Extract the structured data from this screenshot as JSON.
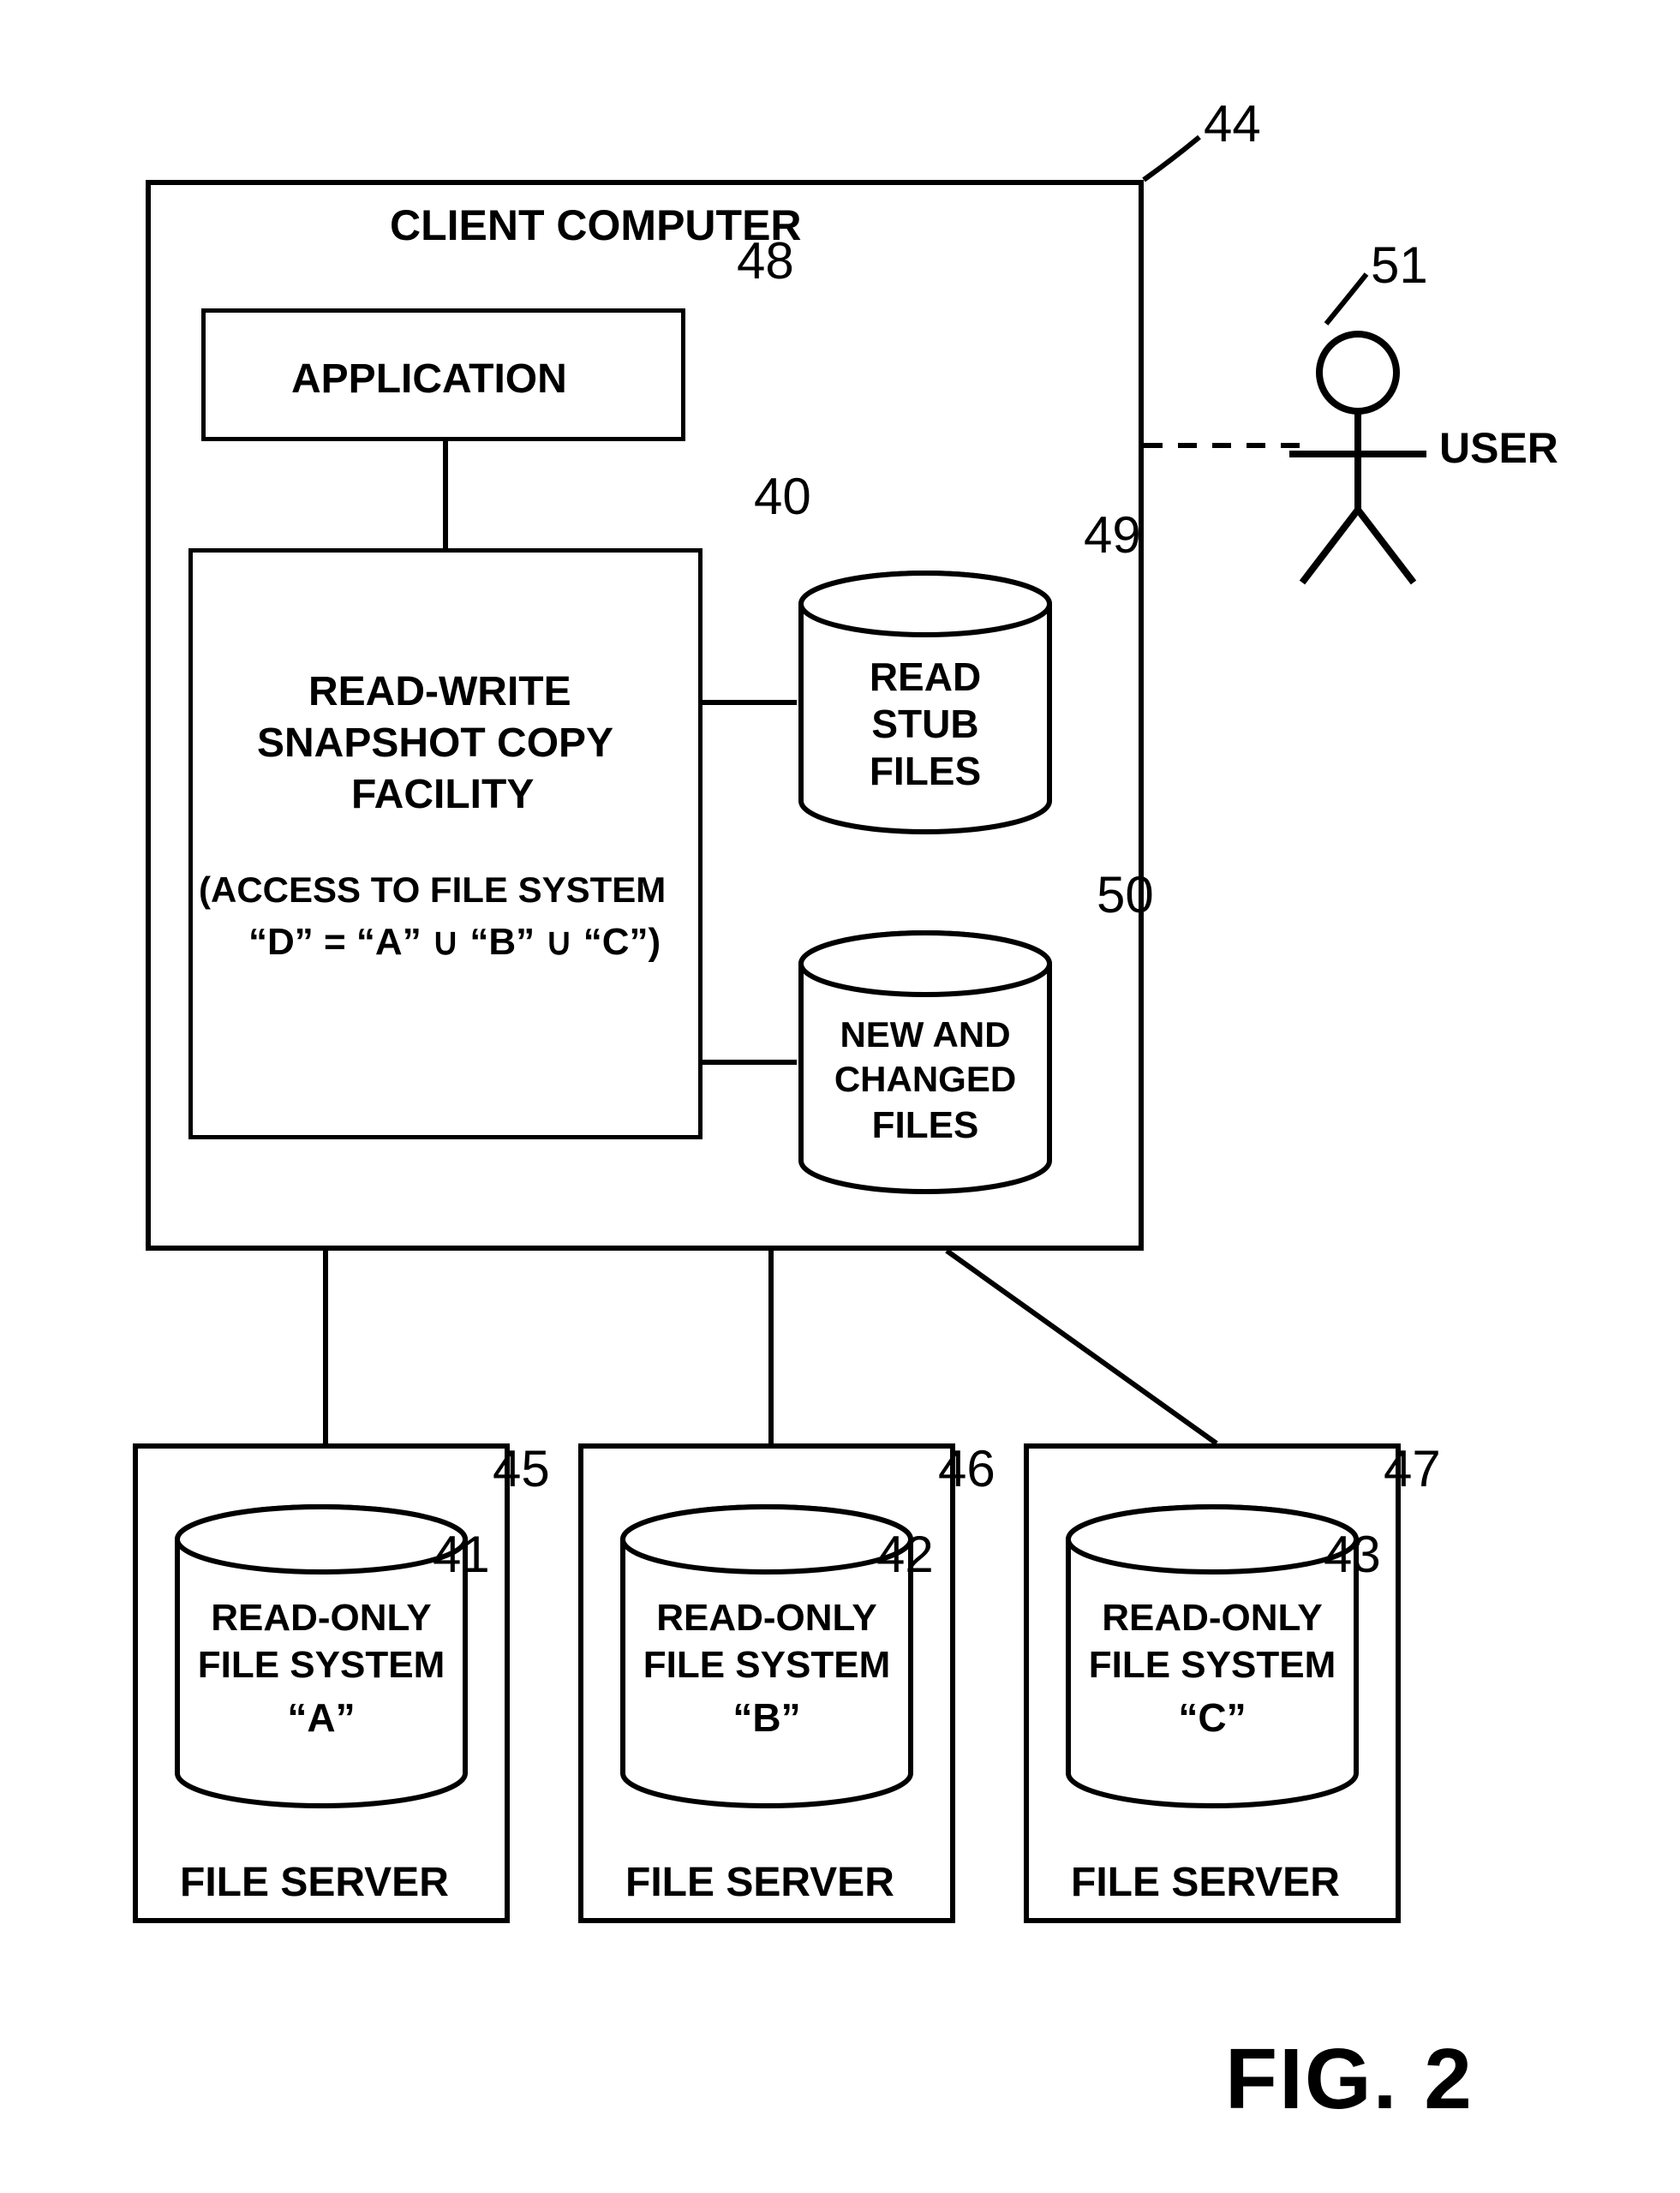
{
  "figure_label": "FIG. 2",
  "client": {
    "title": "CLIENT COMPUTER",
    "ref": "44",
    "application": {
      "label": "APPLICATION",
      "ref": "48"
    },
    "facility": {
      "line1": "READ-WRITE",
      "line2": "SNAPSHOT COPY",
      "line3": "FACILITY",
      "line4": "(ACCESS TO FILE SYSTEM",
      "line5": "“D” = “A” ∪ “B” ∪ “C”)",
      "ref": "40"
    },
    "stub": {
      "line1": "READ",
      "line2": "STUB",
      "line3": "FILES",
      "ref": "49"
    },
    "changed": {
      "line1": "NEW AND",
      "line2": "CHANGED",
      "line3": "FILES",
      "ref": "50"
    }
  },
  "user": {
    "label": "USER",
    "ref": "51"
  },
  "servers": [
    {
      "box_ref": "45",
      "cyl_ref": "41",
      "server_label": "FILE SERVER",
      "fs_line1": "READ-ONLY",
      "fs_line2": "FILE SYSTEM",
      "fs_line3": "“A”"
    },
    {
      "box_ref": "46",
      "cyl_ref": "42",
      "server_label": "FILE SERVER",
      "fs_line1": "READ-ONLY",
      "fs_line2": "FILE SYSTEM",
      "fs_line3": "“B”"
    },
    {
      "box_ref": "47",
      "cyl_ref": "43",
      "server_label": "FILE SERVER",
      "fs_line1": "READ-ONLY",
      "fs_line2": "FILE SYSTEM",
      "fs_line3": "“C”"
    }
  ]
}
